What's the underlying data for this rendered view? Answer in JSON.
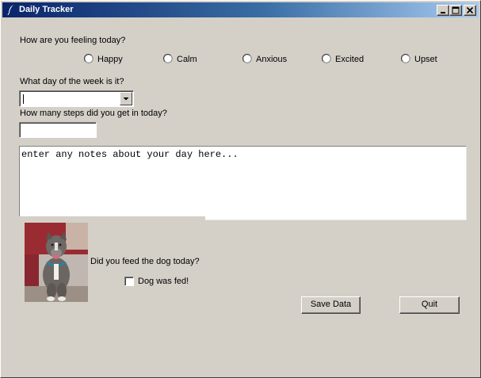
{
  "window": {
    "title": "Daily Tracker",
    "controls": [
      "minimize",
      "maximize",
      "close"
    ]
  },
  "feeling": {
    "question": "How are you feeling today?",
    "options": [
      "Happy",
      "Calm",
      "Anxious",
      "Excited",
      "Upset"
    ],
    "selected": null
  },
  "day": {
    "question": "What day of the week is it?",
    "value": ""
  },
  "steps": {
    "question": "How many steps did you get in today?",
    "value": ""
  },
  "notes": {
    "value": "enter any notes about your day here..."
  },
  "dog": {
    "question": "Did you feed the dog today?",
    "checkbox_label": "Dog was fed!",
    "checked": false,
    "photo_icon": "dog-photo"
  },
  "buttons": {
    "save_label": "Save Data",
    "quit_label": "Quit"
  },
  "colors": {
    "titlebar_start": "#0a246a",
    "titlebar_end": "#a6caf0",
    "face": "#d4d0c8"
  }
}
